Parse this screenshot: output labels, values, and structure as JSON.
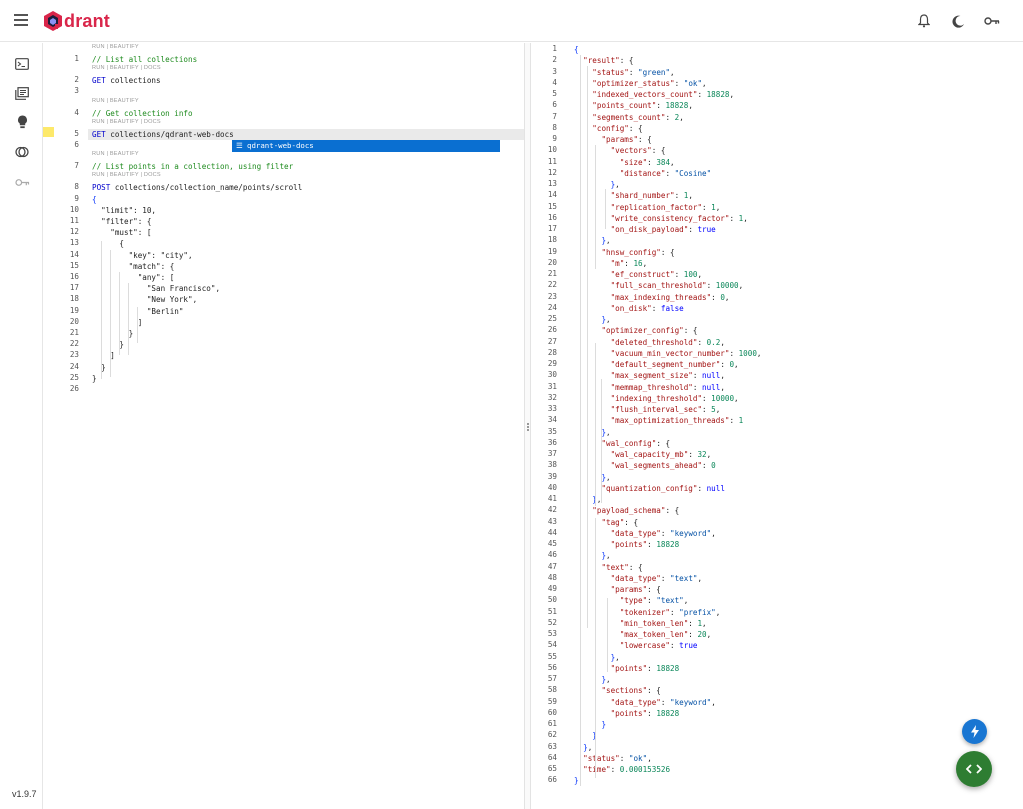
{
  "app": {
    "brand": "drant",
    "version": "v1.9.7"
  },
  "colors": {
    "brand": "#d9264a",
    "comment": "#1e8b1e",
    "string": "#a31515",
    "number": "#098658",
    "keyword": "#0000ff",
    "autocomplete_bg": "#0a6fd1",
    "fab_bolt": "#1976d2",
    "fab_code": "#2e7d32"
  },
  "topbar": {
    "icons": [
      "bell-icon",
      "moon-icon",
      "key-icon"
    ]
  },
  "sidebar": {
    "icons": [
      "console-icon",
      "collections-icon",
      "tutorial-lightbulb-icon",
      "datasets-icon",
      "api-key-icon"
    ]
  },
  "editor": {
    "autocomplete": "qdrant-web-docs",
    "lines": [
      {
        "n": "",
        "lens": "RUN | BEAUTIFY"
      },
      {
        "n": "1",
        "code": "// List all collections",
        "cls": "c-comment"
      },
      {
        "n": "",
        "lens": "RUN | BEAUTIFY | DOCS"
      },
      {
        "n": "2",
        "method": "GET",
        "code": " collections"
      },
      {
        "n": "3",
        "code": ""
      },
      {
        "n": "",
        "lens": "RUN | BEAUTIFY"
      },
      {
        "n": "4",
        "code": "// Get collection info",
        "cls": "c-comment"
      },
      {
        "n": "",
        "lens": "RUN | BEAUTIFY | DOCS"
      },
      {
        "n": "5",
        "method": "GET",
        "code": " collections/qdrant-web-docs",
        "highlight": true
      },
      {
        "n": "6",
        "code": ""
      },
      {
        "n": "",
        "lens": "RUN | BEAUTIFY"
      },
      {
        "n": "7",
        "code": "// List points in a collection, using filter",
        "cls": "c-comment"
      },
      {
        "n": "",
        "lens": "RUN | BEAUTIFY | DOCS"
      },
      {
        "n": "8",
        "method": "POST",
        "code": " collections/collection_name/points/scroll"
      },
      {
        "n": "9",
        "code": "{",
        "cls": "c-brace"
      },
      {
        "n": "10",
        "code": "  \"limit\": 10,"
      },
      {
        "n": "11",
        "code": "  \"filter\": {"
      },
      {
        "n": "12",
        "code": "    \"must\": ["
      },
      {
        "n": "13",
        "code": "      {"
      },
      {
        "n": "14",
        "code": "        \"key\": \"city\","
      },
      {
        "n": "15",
        "code": "        \"match\": {"
      },
      {
        "n": "16",
        "code": "          \"any\": ["
      },
      {
        "n": "17",
        "code": "            \"San Francisco\","
      },
      {
        "n": "18",
        "code": "            \"New York\","
      },
      {
        "n": "19",
        "code": "            \"Berlin\""
      },
      {
        "n": "20",
        "code": "          ]"
      },
      {
        "n": "21",
        "code": "        }"
      },
      {
        "n": "22",
        "code": "      }"
      },
      {
        "n": "23",
        "code": "    ]"
      },
      {
        "n": "24",
        "code": "  }"
      },
      {
        "n": "25",
        "code": "}"
      },
      {
        "n": "26",
        "code": ""
      }
    ]
  },
  "result": {
    "lines": [
      "{",
      "  \"result\": {",
      "    \"status\": \"green\",",
      "    \"optimizer_status\": \"ok\",",
      "    \"indexed_vectors_count\": 18828,",
      "    \"points_count\": 18828,",
      "    \"segments_count\": 2,",
      "    \"config\": {",
      "      \"params\": {",
      "        \"vectors\": {",
      "          \"size\": 384,",
      "          \"distance\": \"Cosine\"",
      "        },",
      "        \"shard_number\": 1,",
      "        \"replication_factor\": 1,",
      "        \"write_consistency_factor\": 1,",
      "        \"on_disk_payload\": true",
      "      },",
      "      \"hnsw_config\": {",
      "        \"m\": 16,",
      "        \"ef_construct\": 100,",
      "        \"full_scan_threshold\": 10000,",
      "        \"max_indexing_threads\": 0,",
      "        \"on_disk\": false",
      "      },",
      "      \"optimizer_config\": {",
      "        \"deleted_threshold\": 0.2,",
      "        \"vacuum_min_vector_number\": 1000,",
      "        \"default_segment_number\": 0,",
      "        \"max_segment_size\": null,",
      "        \"memmap_threshold\": null,",
      "        \"indexing_threshold\": 10000,",
      "        \"flush_interval_sec\": 5,",
      "        \"max_optimization_threads\": 1",
      "      },",
      "      \"wal_config\": {",
      "        \"wal_capacity_mb\": 32,",
      "        \"wal_segments_ahead\": 0",
      "      },",
      "      \"quantization_config\": null",
      "    },",
      "    \"payload_schema\": {",
      "      \"tag\": {",
      "        \"data_type\": \"keyword\",",
      "        \"points\": 18828",
      "      },",
      "      \"text\": {",
      "        \"data_type\": \"text\",",
      "        \"params\": {",
      "          \"type\": \"text\",",
      "          \"tokenizer\": \"prefix\",",
      "          \"min_token_len\": 1,",
      "          \"max_token_len\": 20,",
      "          \"lowercase\": true",
      "        },",
      "        \"points\": 18828",
      "      },",
      "      \"sections\": {",
      "        \"data_type\": \"keyword\",",
      "        \"points\": 18828",
      "      }",
      "    }",
      "  },",
      "  \"status\": \"ok\",",
      "  \"time\": 0.000153526",
      "}"
    ]
  }
}
